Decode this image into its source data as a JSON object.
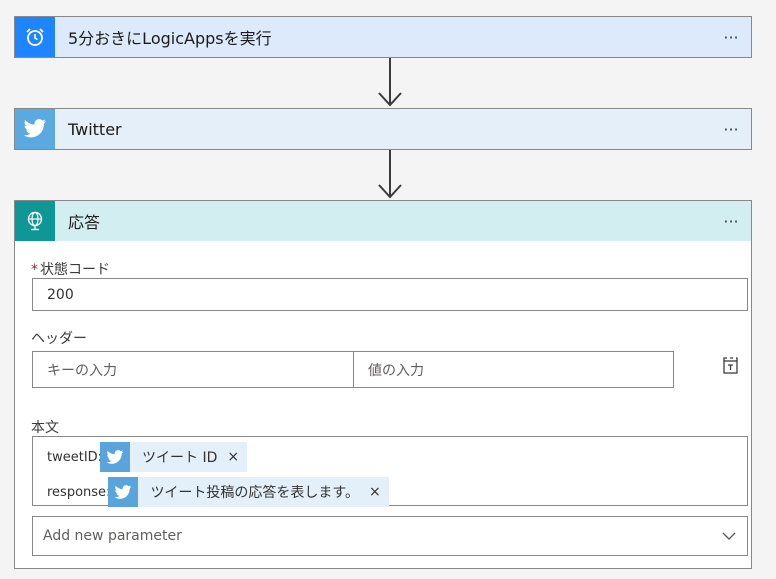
{
  "steps": [
    {
      "title": "5分おきにLogicAppsを実行",
      "icon": "alarm-clock-icon",
      "header_color": "#ddeafb",
      "icon_bg": "#1f85ff"
    },
    {
      "title": "Twitter",
      "icon": "twitter-bird-icon",
      "header_color": "#e4eff9",
      "icon_bg": "#5ba9e1"
    },
    {
      "title": "応答",
      "icon": "globe-icon",
      "header_color": "#d3eef0",
      "icon_bg": "#0f9696"
    }
  ],
  "more_label": "···",
  "response": {
    "status_label": "状態コード",
    "status_required": "*",
    "status_value": "200",
    "headers_label": "ヘッダー",
    "key_placeholder": "キーの入力",
    "value_placeholder": "値の入力",
    "body_label": "本文",
    "body_lines": [
      {
        "prefix": "tweetID:",
        "token": "ツイート ID",
        "close": "×"
      },
      {
        "prefix": "response:",
        "token": "ツイート投稿の応答を表します。",
        "close": "×"
      }
    ],
    "add_param_placeholder": "Add new parameter"
  }
}
